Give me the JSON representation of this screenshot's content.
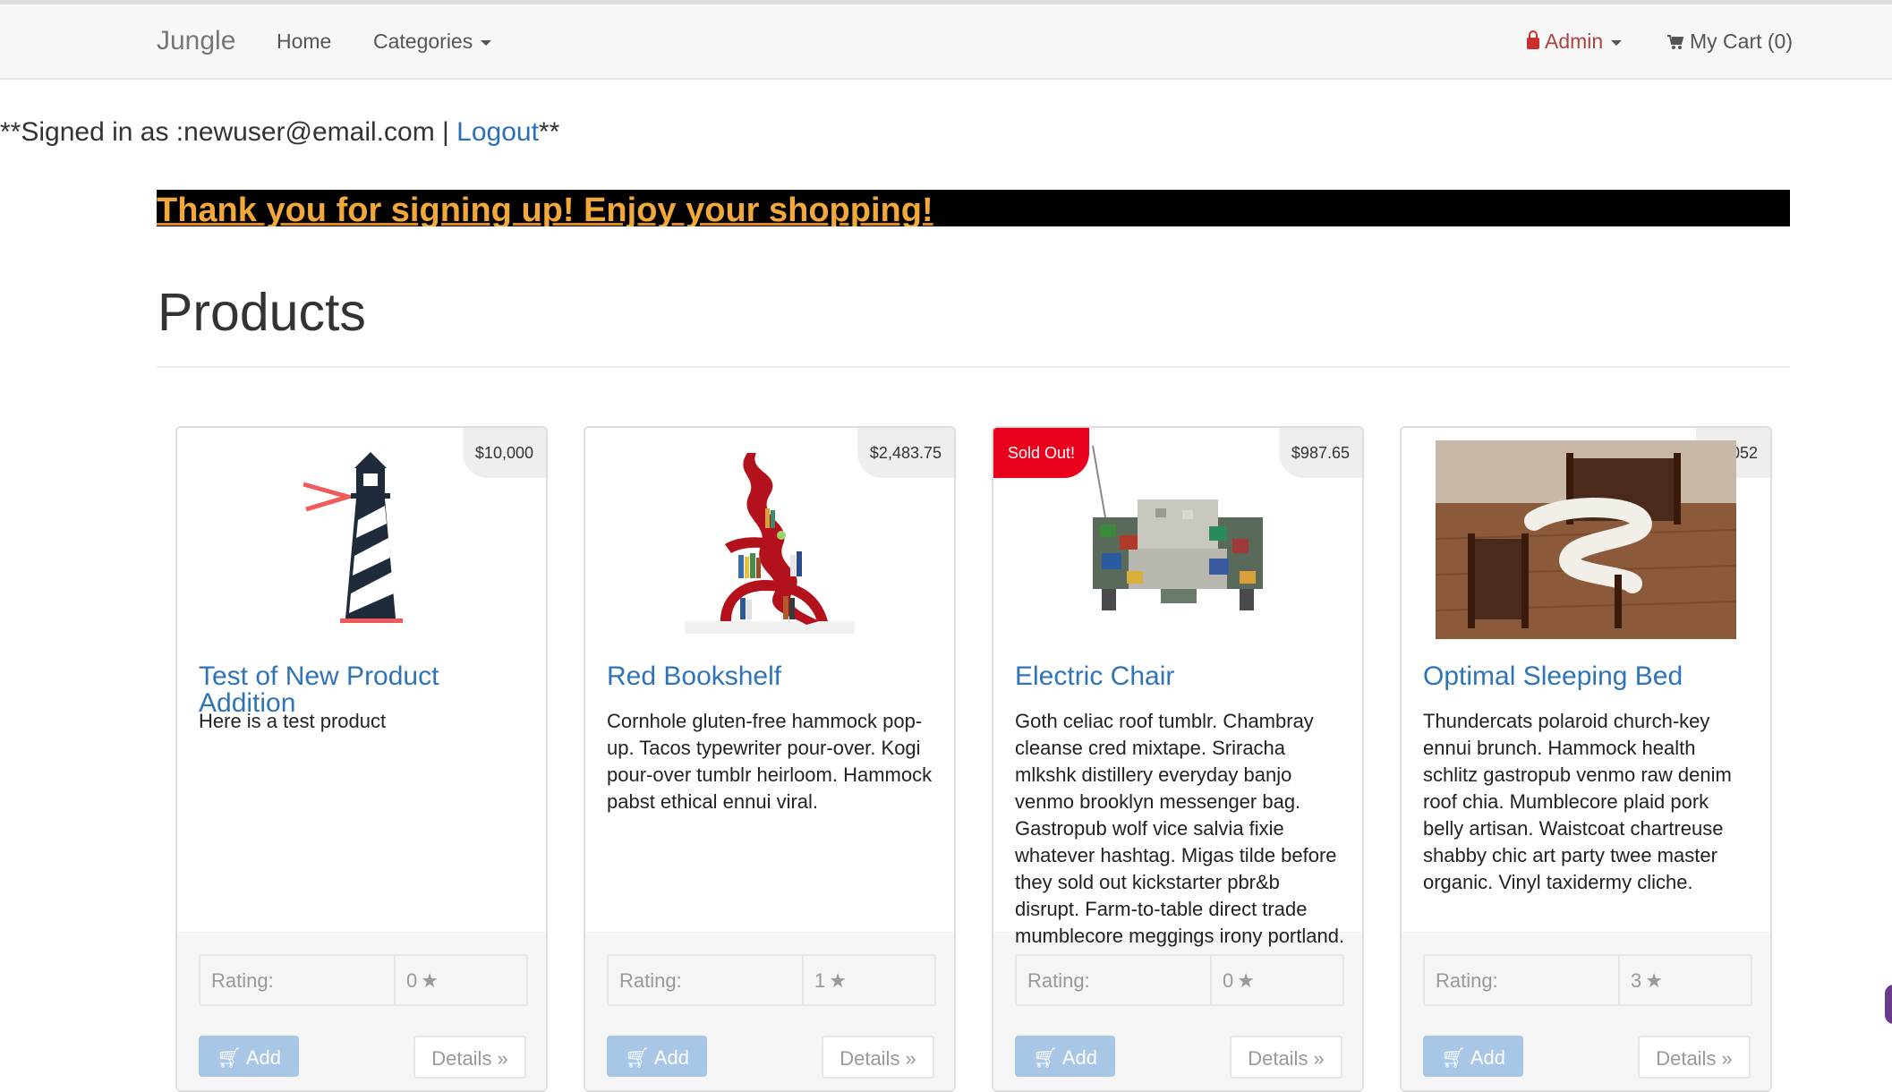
{
  "navbar": {
    "brand": "Jungle",
    "home": "Home",
    "categories": "Categories",
    "admin": "Admin",
    "cart": "My Cart (0)"
  },
  "session": {
    "prefix": "**Signed in as :newuser@email.com | ",
    "logout": "Logout",
    "suffix": "**"
  },
  "banner": {
    "text": "Thank you for signing up! Enjoy your shopping!"
  },
  "page": {
    "title": "Products"
  },
  "products": [
    {
      "name": "Test of New Product Addition",
      "price": "$10,000",
      "description": "Here is a test product",
      "rating_label": "Rating:",
      "rating": "0",
      "add_label": "Add",
      "details_label": "Details »",
      "sold_out": ""
    },
    {
      "name": "Red Bookshelf",
      "price": "$2,483.75",
      "description": "Cornhole gluten-free hammock pop-up. Tacos typewriter pour-over. Kogi pour-over tumblr heirloom. Hammock pabst ethical ennui viral.",
      "rating_label": "Rating:",
      "rating": "1",
      "add_label": "Add",
      "details_label": "Details »",
      "sold_out": ""
    },
    {
      "name": "Electric Chair",
      "price": "$987.65",
      "description": "Goth celiac roof tumblr. Chambray cleanse cred mixtape. Sriracha mlkshk distillery everyday banjo venmo brooklyn messenger bag. Gastropub wolf vice salvia fixie whatever hashtag. Migas tilde before they sold out kickstarter pbr&b disrupt. Farm-to-table direct trade mumblecore meggings irony portland.",
      "rating_label": "Rating:",
      "rating": "0",
      "add_label": "Add",
      "details_label": "Details »",
      "sold_out": "Sold Out!"
    },
    {
      "name": "Optimal Sleeping Bed",
      "price": "$3,052",
      "description": "Thundercats polaroid church-key ennui brunch. Hammock health schlitz gastropub venmo raw denim roof chia. Mumblecore plaid pork belly artisan. Waistcoat chartreuse shabby chic art party twee master organic. Vinyl taxidermy cliche.",
      "rating_label": "Rating:",
      "rating": "3",
      "add_label": "Add",
      "details_label": "Details »",
      "sold_out": ""
    }
  ],
  "colors": {
    "link": "#2f74b5",
    "banner_bg": "#000000",
    "banner_text": "#f3a93a",
    "sold_out": "#e8001c",
    "add_button": "#a8c6e6"
  }
}
